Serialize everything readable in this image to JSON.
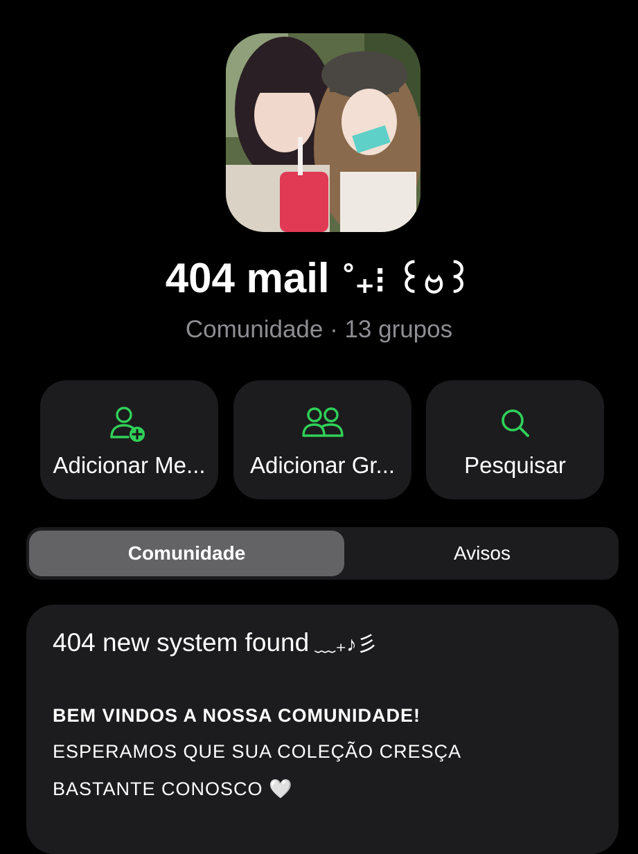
{
  "community": {
    "name": "404 mail",
    "name_decoration": "˚₊⁝ ꒰ဗ꒱",
    "subtitle": "Comunidade · 13 grupos"
  },
  "actions": [
    {
      "label": "Adicionar Me...",
      "icon": "add-person-icon"
    },
    {
      "label": "Adicionar Gr...",
      "icon": "group-icon"
    },
    {
      "label": "Pesquisar",
      "icon": "search-icon"
    }
  ],
  "tabs": [
    {
      "label": "Comunidade",
      "active": true
    },
    {
      "label": "Avisos",
      "active": false
    }
  ],
  "description": {
    "headline": "404 new system found",
    "headline_decoration": "﹏₊♪彡",
    "line1": "BEM VINDOS A NOSSA COMUNIDADE!",
    "line2": "ESPERAMOS QUE SUA COLEÇÃO CRESÇA",
    "line3": "BASTANTE CONOSCO 🤍"
  },
  "colors": {
    "accent": "#30d158",
    "background": "#000000",
    "card": "#1c1c1e",
    "secondary_text": "#8e8e93"
  }
}
